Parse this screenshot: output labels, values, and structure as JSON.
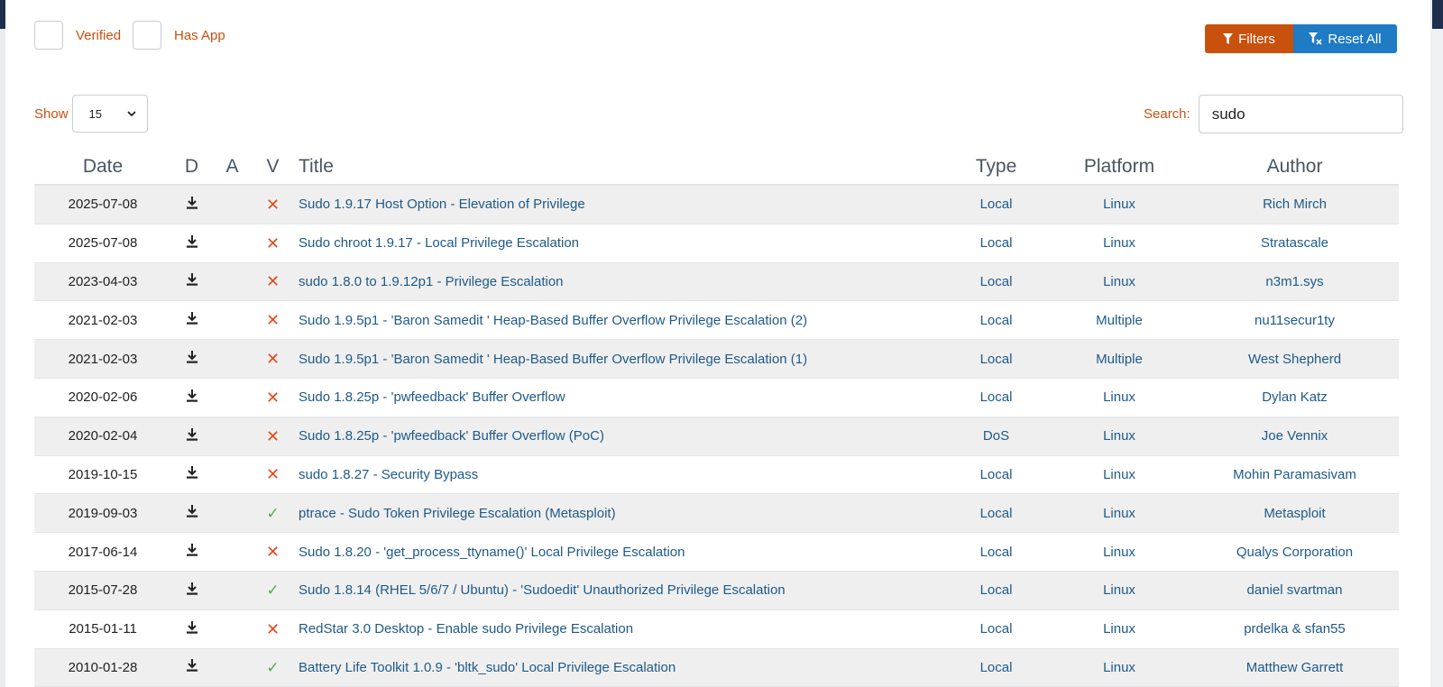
{
  "filters": {
    "verified_label": "Verified",
    "has_app_label": "Has App",
    "filters_button": "Filters",
    "reset_button": "Reset All"
  },
  "length": {
    "show_label": "Show",
    "selected": "15"
  },
  "search": {
    "label": "Search:",
    "value": "sudo"
  },
  "table": {
    "headers": {
      "date": "Date",
      "d": "D",
      "a": "A",
      "v": "V",
      "title": "Title",
      "type": "Type",
      "platform": "Platform",
      "author": "Author"
    },
    "rows": [
      {
        "date": "2025-07-08",
        "verified": false,
        "title": "Sudo 1.9.17 Host Option - Elevation of Privilege",
        "type": "Local",
        "platform": "Linux",
        "author": "Rich Mirch"
      },
      {
        "date": "2025-07-08",
        "verified": false,
        "title": "Sudo chroot 1.9.17 - Local Privilege Escalation",
        "type": "Local",
        "platform": "Linux",
        "author": "Stratascale"
      },
      {
        "date": "2023-04-03",
        "verified": false,
        "title": "sudo 1.8.0 to 1.9.12p1 - Privilege Escalation",
        "type": "Local",
        "platform": "Linux",
        "author": "n3m1.sys"
      },
      {
        "date": "2021-02-03",
        "verified": false,
        "title": "Sudo 1.9.5p1 - 'Baron Samedit ' Heap-Based Buffer Overflow Privilege Escalation (2)",
        "type": "Local",
        "platform": "Multiple",
        "author": "nu11secur1ty"
      },
      {
        "date": "2021-02-03",
        "verified": false,
        "title": "Sudo 1.9.5p1 - 'Baron Samedit ' Heap-Based Buffer Overflow Privilege Escalation (1)",
        "type": "Local",
        "platform": "Multiple",
        "author": "West Shepherd"
      },
      {
        "date": "2020-02-06",
        "verified": false,
        "title": "Sudo 1.8.25p - 'pwfeedback' Buffer Overflow",
        "type": "Local",
        "platform": "Linux",
        "author": "Dylan Katz"
      },
      {
        "date": "2020-02-04",
        "verified": false,
        "title": "Sudo 1.8.25p - 'pwfeedback' Buffer Overflow (PoC)",
        "type": "DoS",
        "platform": "Linux",
        "author": "Joe Vennix"
      },
      {
        "date": "2019-10-15",
        "verified": false,
        "title": "sudo 1.8.27 - Security Bypass",
        "type": "Local",
        "platform": "Linux",
        "author": "Mohin Paramasivam"
      },
      {
        "date": "2019-09-03",
        "verified": true,
        "title": "ptrace - Sudo Token Privilege Escalation (Metasploit)",
        "type": "Local",
        "platform": "Linux",
        "author": "Metasploit"
      },
      {
        "date": "2017-06-14",
        "verified": false,
        "title": "Sudo 1.8.20 - 'get_process_ttyname()' Local Privilege Escalation",
        "type": "Local",
        "platform": "Linux",
        "author": "Qualys Corporation"
      },
      {
        "date": "2015-07-28",
        "verified": true,
        "title": "Sudo 1.8.14 (RHEL 5/6/7 / Ubuntu) - 'Sudoedit' Unauthorized Privilege Escalation",
        "type": "Local",
        "platform": "Linux",
        "author": "daniel svartman"
      },
      {
        "date": "2015-01-11",
        "verified": false,
        "title": "RedStar 3.0 Desktop - Enable sudo Privilege Escalation",
        "type": "Local",
        "platform": "Linux",
        "author": "prdelka & sfan55"
      },
      {
        "date": "2010-01-28",
        "verified": true,
        "title": "Battery Life Toolkit 1.0.9 - 'bltk_sudo' Local Privilege Escalation",
        "type": "Local",
        "platform": "Linux",
        "author": "Matthew Garrett"
      }
    ]
  },
  "icons": {
    "download": "download-icon",
    "unverified": "x-mark-icon",
    "verified": "check-mark-icon"
  },
  "colors": {
    "accent_orange": "#c8510e",
    "accent_blue": "#1e7bc4",
    "link": "#1e5a8a",
    "x_mark": "#e54b1c",
    "check_mark": "#4caf50"
  }
}
